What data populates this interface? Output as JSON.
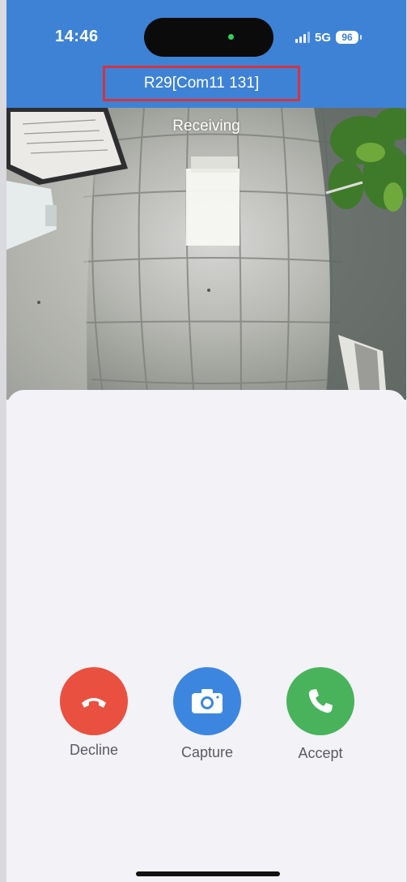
{
  "status_bar": {
    "time": "14:46",
    "network": "5G",
    "battery": "96"
  },
  "header": {
    "title": "R29[Com11 131]"
  },
  "video": {
    "status": "Receiving"
  },
  "actions": {
    "decline": {
      "label": "Decline",
      "color": "#e9503f",
      "icon": "phone-hangup-icon"
    },
    "capture": {
      "label": "Capture",
      "color": "#3d86e0",
      "icon": "camera-icon"
    },
    "accept": {
      "label": "Accept",
      "color": "#48b35a",
      "icon": "phone-icon"
    }
  },
  "colors": {
    "header_bg": "#3e82d6",
    "highlight_border": "#d4333f",
    "sheet_bg": "#f2f2f7"
  }
}
